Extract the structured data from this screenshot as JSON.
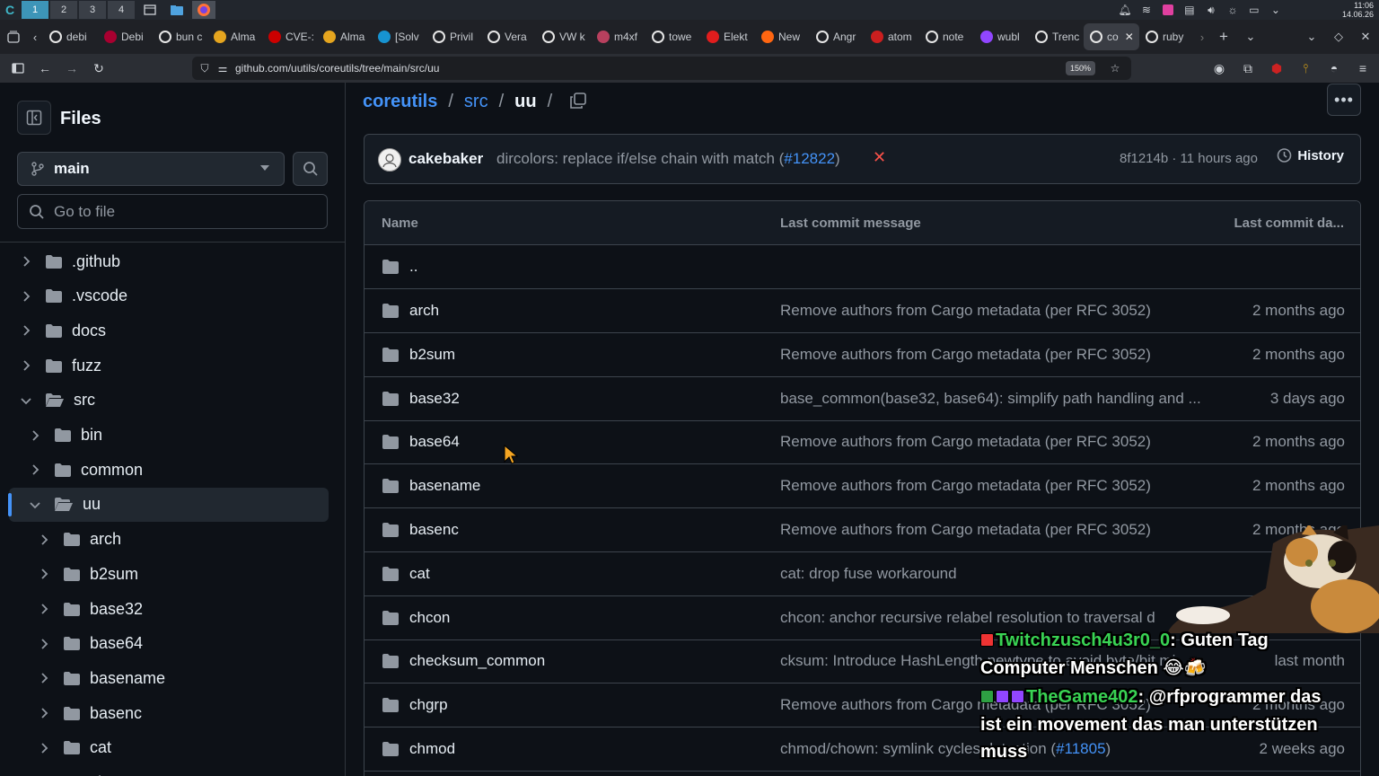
{
  "os_bar": {
    "workspaces": [
      "1",
      "2",
      "3",
      "4"
    ],
    "active_workspace": "1",
    "clock_time": "11:06",
    "clock_date": "14.06.26"
  },
  "browser": {
    "tabs": [
      {
        "label": "debi",
        "icon": "google-icon",
        "color": "#ffffff"
      },
      {
        "label": "Debi",
        "icon": "debian-icon",
        "color": "#a80030"
      },
      {
        "label": "bun c",
        "icon": "google-icon",
        "color": "#ffffff"
      },
      {
        "label": "Alma",
        "icon": "alma-icon",
        "color": "#e5a51f"
      },
      {
        "label": "CVE-:",
        "icon": "redhat-icon",
        "color": "#cc0000"
      },
      {
        "label": "Alma",
        "icon": "alma-icon",
        "color": "#e5a51f"
      },
      {
        "label": "[Solv",
        "icon": "arch-icon",
        "color": "#1793d1"
      },
      {
        "label": "Privil",
        "icon": "safari-icon",
        "color": "#ffffff"
      },
      {
        "label": "Vera",
        "icon": "star-icon",
        "color": "#ffffff"
      },
      {
        "label": "VW k",
        "icon": "safari-icon",
        "color": "#ffffff"
      },
      {
        "label": "m4xf",
        "icon": "n-icon",
        "color": "#b8405e"
      },
      {
        "label": "towe",
        "icon": "google-icon",
        "color": "#ffffff"
      },
      {
        "label": "Elekt",
        "icon": "a-icon",
        "color": "#e11d1d"
      },
      {
        "label": "New",
        "icon": "firefox-icon",
        "color": "#ff6611"
      },
      {
        "label": "Angr",
        "icon": "safari-icon",
        "color": "#ffffff"
      },
      {
        "label": "atom",
        "icon": "book-icon",
        "color": "#cc1f1f"
      },
      {
        "label": "note",
        "icon": "google-icon",
        "color": "#ffffff"
      },
      {
        "label": "wubl",
        "icon": "twitch-icon",
        "color": "#9146ff"
      },
      {
        "label": "Trenc",
        "icon": "github-icon",
        "color": "#ffffff"
      },
      {
        "label": "co",
        "icon": "github-icon",
        "color": "#ffffff",
        "active": true
      },
      {
        "label": "ruby",
        "icon": "google-icon",
        "color": "#ffffff"
      }
    ],
    "url": "github.com/uutils/coreutils/tree/main/src/uu",
    "zoom": "150%"
  },
  "sidebar": {
    "title": "Files",
    "branch": "main",
    "search_placeholder": "Go to file",
    "tree": [
      {
        "name": ".github",
        "depth": 0,
        "expanded": false
      },
      {
        "name": ".vscode",
        "depth": 0,
        "expanded": false
      },
      {
        "name": "docs",
        "depth": 0,
        "expanded": false
      },
      {
        "name": "fuzz",
        "depth": 0,
        "expanded": false
      },
      {
        "name": "src",
        "depth": 0,
        "expanded": true
      },
      {
        "name": "bin",
        "depth": 1,
        "expanded": false
      },
      {
        "name": "common",
        "depth": 1,
        "expanded": false
      },
      {
        "name": "uu",
        "depth": 1,
        "expanded": true,
        "selected": true
      },
      {
        "name": "arch",
        "depth": 2,
        "expanded": false
      },
      {
        "name": "b2sum",
        "depth": 2,
        "expanded": false
      },
      {
        "name": "base32",
        "depth": 2,
        "expanded": false
      },
      {
        "name": "base64",
        "depth": 2,
        "expanded": false
      },
      {
        "name": "basename",
        "depth": 2,
        "expanded": false
      },
      {
        "name": "basenc",
        "depth": 2,
        "expanded": false
      },
      {
        "name": "cat",
        "depth": 2,
        "expanded": false
      },
      {
        "name": "chcon",
        "depth": 2,
        "expanded": false
      }
    ]
  },
  "breadcrumb": {
    "root": "coreutils",
    "middle": "src",
    "current": "uu",
    "sep": "/"
  },
  "commit": {
    "author": "cakebaker",
    "message": "dircolors: replace if/else chain with match (",
    "pr": "#12822",
    "message_end": ")",
    "status": "failed",
    "hash_time": "8f1214b · 11 hours ago",
    "history_label": "History"
  },
  "files": {
    "headers": {
      "name": "Name",
      "message": "Last commit message",
      "date": "Last commit da..."
    },
    "parent": "..",
    "rows": [
      {
        "name": "arch",
        "message": "Remove authors from Cargo metadata (per RFC 3052)",
        "date": "2 months ago"
      },
      {
        "name": "b2sum",
        "message": "Remove authors from Cargo metadata (per RFC 3052)",
        "date": "2 months ago"
      },
      {
        "name": "base32",
        "message": "base_common(base32, base64): simplify path handling and ...",
        "date": "3 days ago"
      },
      {
        "name": "base64",
        "message": "Remove authors from Cargo metadata (per RFC 3052)",
        "date": "2 months ago"
      },
      {
        "name": "basename",
        "message": "Remove authors from Cargo metadata (per RFC 3052)",
        "date": "2 months ago"
      },
      {
        "name": "basenc",
        "message": "Remove authors from Cargo metadata (per RFC 3052)",
        "date": "2 months ago"
      },
      {
        "name": "cat",
        "message": "cat: drop fuse workaround",
        "date": ""
      },
      {
        "name": "chcon",
        "message": "chcon: anchor recursive relabel resolution to traversal d",
        "date": ""
      },
      {
        "name": "checksum_common",
        "message": "cksum: Introduce HashLength newtype to avoid byte/bit mi",
        "date": "last month"
      },
      {
        "name": "chgrp",
        "message": "Remove authors from Cargo metadata (per RFC 3052)",
        "date": "2 months ago"
      },
      {
        "name": "chmod",
        "message": "chmod/chown: symlink cycles detection (",
        "pr": "#11805",
        "message_end": ")",
        "date": "2 weeks ago"
      }
    ]
  },
  "chat": [
    {
      "user": "Twitchzusch4u3r0_0",
      "text": ": Guten Tag"
    },
    {
      "user": "",
      "text": "Computer Menschen 😂🍻"
    },
    {
      "user": "TheGame402",
      "text": ": @rfprogrammer das"
    },
    {
      "user": "",
      "text": "ist ein movement das man unterstützen"
    },
    {
      "user": "",
      "text": "muss"
    }
  ],
  "colors": {
    "link": "#4493f8",
    "muted": "#9198a1",
    "folder": "#9198a1",
    "fail": "#f85149",
    "chat_user": "#39d353"
  }
}
